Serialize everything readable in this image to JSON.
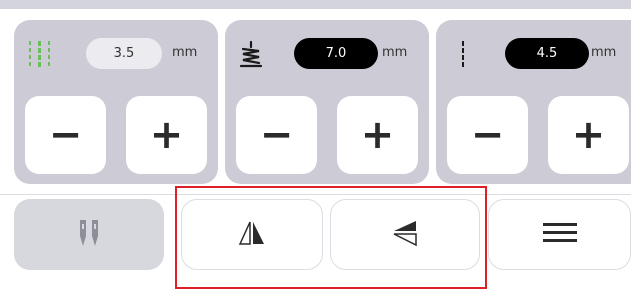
{
  "stitch_width": {
    "icon": "stitch-width-icon",
    "value": "3.5",
    "unit": "mm",
    "minus": "−",
    "plus": "+"
  },
  "stitch_length": {
    "icon": "stitch-length-icon",
    "value": "7.0",
    "unit": "mm",
    "minus": "−",
    "plus": "+"
  },
  "needle_position": {
    "icon": "needle-position-icon",
    "value": "4.5",
    "unit": "mm",
    "minus": "−",
    "plus": "+"
  },
  "tools": [
    {
      "icon": "twin-needle-icon"
    },
    {
      "icon": "mirror-vertical-icon"
    },
    {
      "icon": "mirror-horizontal-icon"
    },
    {
      "icon": "menu-icon"
    }
  ],
  "colors": {
    "accent_green": "#6bbf59",
    "highlight_red": "#dd1f26",
    "panel_gray": "#cdccd6"
  }
}
